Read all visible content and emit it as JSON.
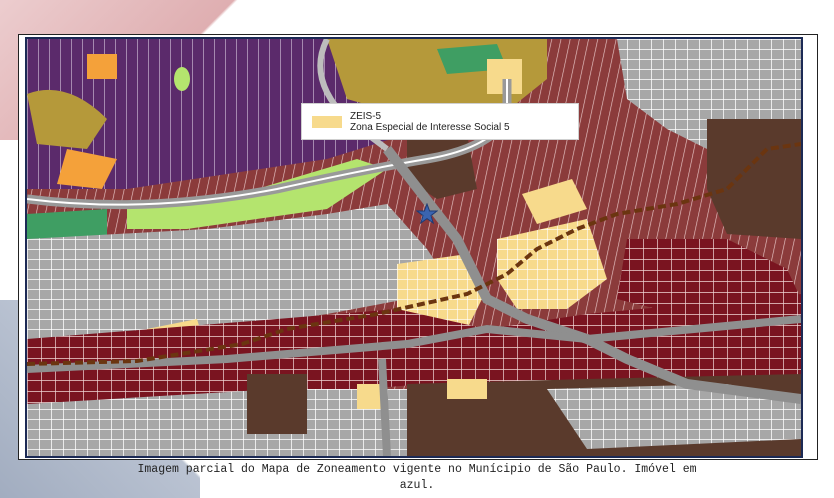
{
  "legend": {
    "swatch_color": "#f7da8c",
    "code": "ZEIS-5",
    "description": "Zona Especial de Interesse Social 5"
  },
  "marker": {
    "icon": "star-icon",
    "color": "#3a64b0"
  },
  "caption": {
    "line1": "Imagem parcial do Mapa de Zoneamento vigente no Munícipio de São Paulo. Imóvel em",
    "line2": "azul."
  },
  "colors": {
    "residential_maroon": "#8b3b3b",
    "dark_red": "#7a1420",
    "zeis5_yellow": "#f7da8c",
    "gray": "#a7a7a7",
    "purple": "#5b2a6b",
    "light_green": "#b4e46e",
    "green": "#3f9e63",
    "olive": "#b5993a",
    "brown": "#5a3a2c",
    "orange": "#f4a13a"
  }
}
